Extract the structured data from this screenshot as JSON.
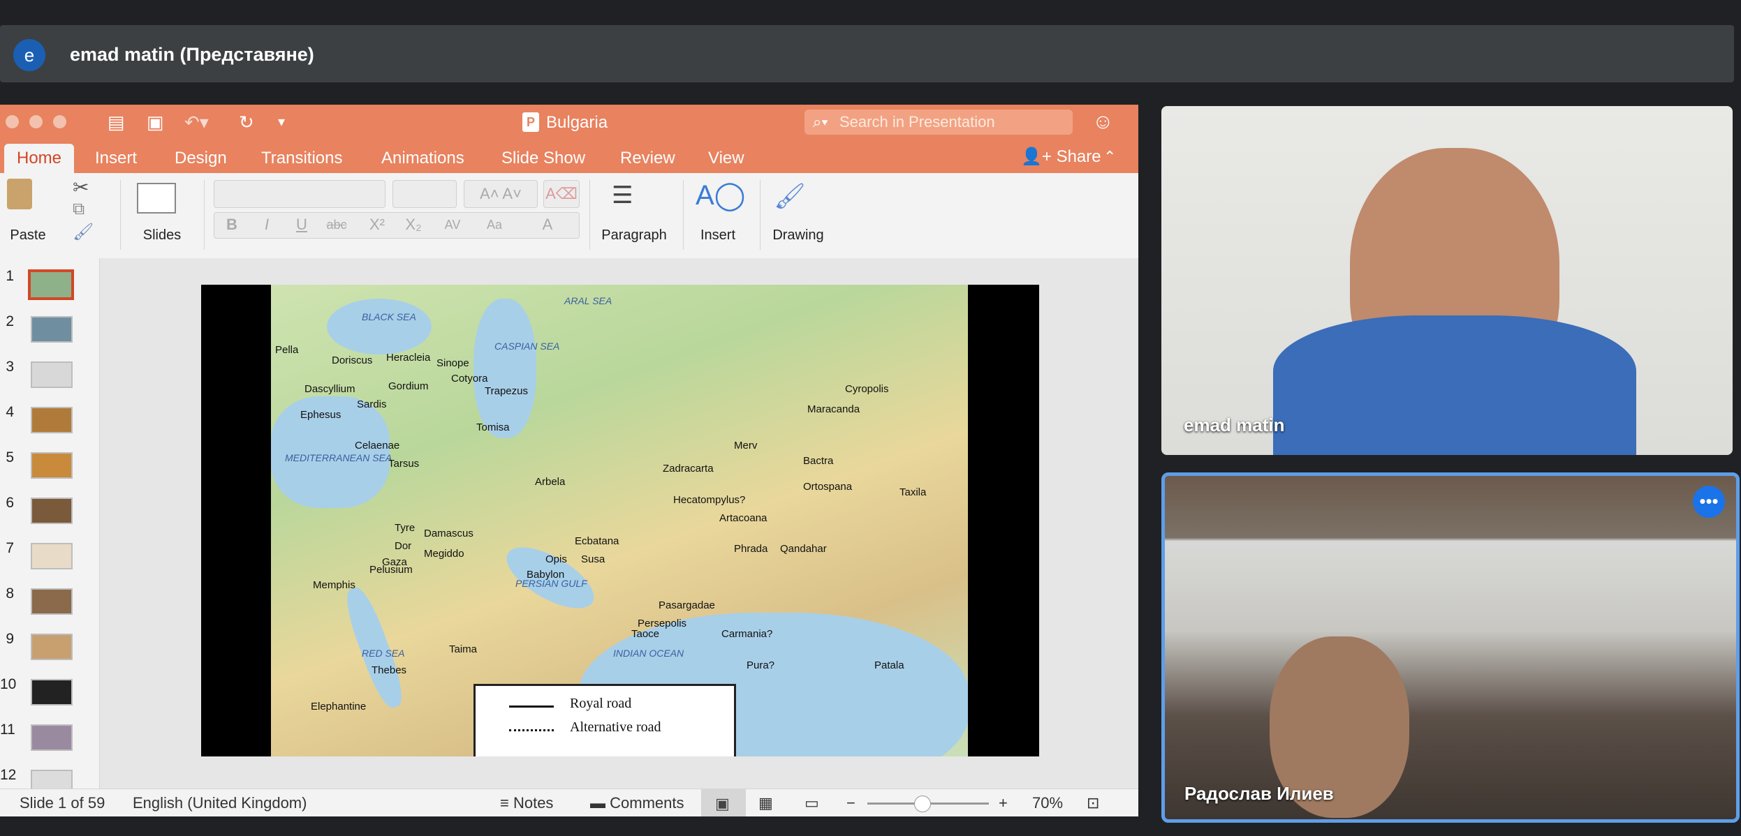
{
  "presenter": {
    "avatar_letter": "e",
    "name": "emad matin (Представяне)"
  },
  "ppt": {
    "doc_title": "Bulgaria",
    "search_placeholder": "Search in Presentation",
    "tabs": [
      "Home",
      "Insert",
      "Design",
      "Transitions",
      "Animations",
      "Slide Show",
      "Review",
      "View"
    ],
    "share_label": "Share",
    "ribbon": {
      "paste": "Paste",
      "slides": "Slides",
      "paragraph": "Paragraph",
      "insert": "Insert",
      "drawing": "Drawing",
      "format_buttons": [
        "B",
        "I",
        "U",
        "abc",
        "X²",
        "X₂",
        "AV",
        "Aa",
        "A"
      ]
    },
    "slide_numbers": [
      "1",
      "2",
      "3",
      "4",
      "5",
      "6",
      "7",
      "8",
      "9",
      "10",
      "11",
      "12"
    ],
    "thumb_colors": [
      "#8fb18a",
      "#6f8fa0",
      "#d8d8d8",
      "#b07b3a",
      "#c98a3c",
      "#7a5a3a",
      "#e8dcc8",
      "#8a6a4a",
      "#c8a070",
      "#222222",
      "#9a8aa0",
      "#dcdcdc"
    ],
    "map": {
      "seas": [
        "BLACK SEA",
        "CASPIAN SEA",
        "MEDITERRANEAN SEA",
        "PERSIAN GULF",
        "RED SEA",
        "INDIAN OCEAN",
        "ARAL SEA"
      ],
      "cities": [
        "Pella",
        "Doriscus",
        "Heracleia",
        "Sinope",
        "Cotyora",
        "Dascyllium",
        "Gordium",
        "Trapezus",
        "Sardis",
        "Ephesus",
        "Celaenae",
        "Tomisa",
        "Tarsus",
        "Arbela",
        "Zadracarta",
        "Merv",
        "Bactra",
        "Maracanda",
        "Cyropolis",
        "Ortospana",
        "Taxila",
        "Hecatompylus?",
        "Ecbatana",
        "Artacoana",
        "Phrada",
        "Qandahar",
        "Tyre",
        "Damascus",
        "Dor",
        "Megiddo",
        "Gaza",
        "Pelusium",
        "Memphis",
        "Opis",
        "Susa",
        "Babylon",
        "Pasargadae",
        "Persepolis",
        "Taoce",
        "Carmania?",
        "Pura?",
        "Patala",
        "Thebes",
        "Taima",
        "Elephantine"
      ],
      "legend": [
        "Royal road",
        "Alternative road"
      ]
    },
    "status": {
      "slide": "Slide 1 of 59",
      "language": "English (United Kingdom)",
      "notes": "Notes",
      "comments": "Comments",
      "zoom": "70%",
      "zoom_fraction": 0.45
    }
  },
  "participants": [
    {
      "name": "emad matin"
    },
    {
      "name": "Радослав Илиев"
    }
  ]
}
